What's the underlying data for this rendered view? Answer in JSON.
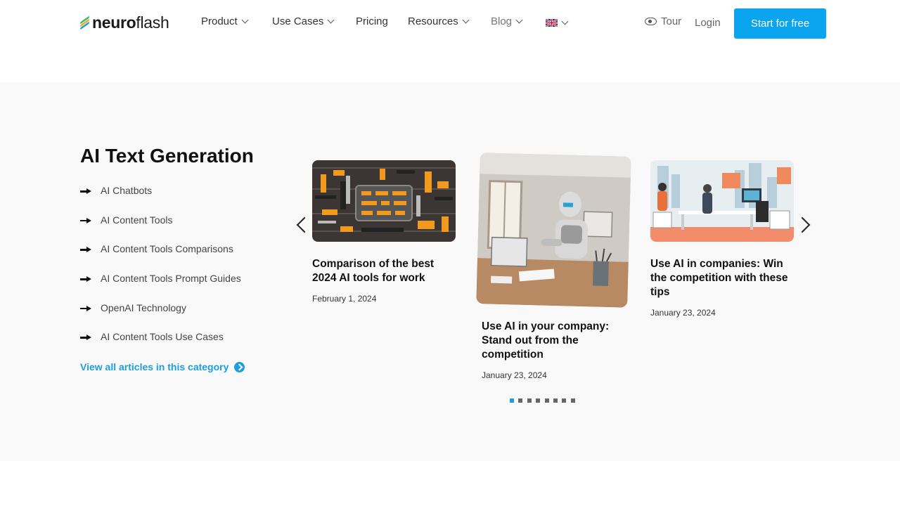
{
  "brand": {
    "logo_bold": "neuro",
    "logo_light": "flash"
  },
  "nav": {
    "product": "Product",
    "use_cases": "Use Cases",
    "pricing": "Pricing",
    "resources": "Resources",
    "blog": "Blog",
    "tour": "Tour",
    "login": "Login",
    "cta": "Start for free"
  },
  "section": {
    "title": "AI Text Generation",
    "categories": [
      "AI Chatbots",
      "AI Content Tools",
      "AI Content Tools Comparisons",
      "AI Content Tools Prompt Guides",
      "OpenAI Technology",
      "AI Content Tools Use Cases"
    ],
    "view_all": "View all articles in this category"
  },
  "cards": [
    {
      "title": "Comparison of the best 2024 AI tools for work",
      "date": "February 1, 2024"
    },
    {
      "title": "Use AI in your company: Stand out from the competition",
      "date": "January 23, 2024"
    },
    {
      "title": "Use AI in companies: Win the competition with these tips",
      "date": "January 23, 2024"
    }
  ],
  "carousel": {
    "dot_count": 8,
    "active_index": 0
  },
  "colors": {
    "accent": "#0aa5ee",
    "link": "#1c9ee0",
    "section_bg": "#f9f9f9"
  }
}
